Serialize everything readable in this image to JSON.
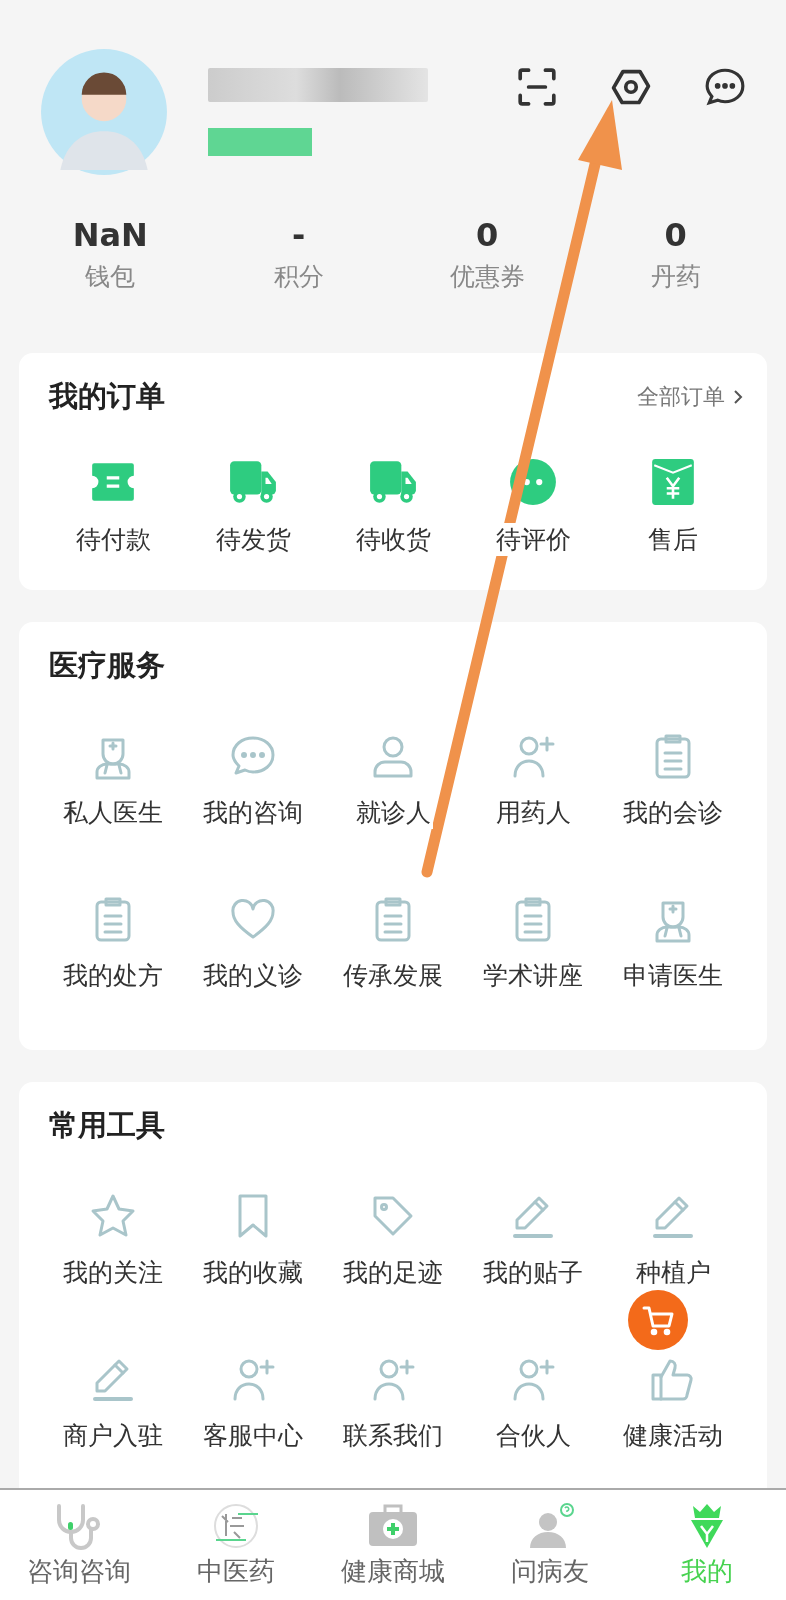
{
  "header": {
    "actions": [
      {
        "kind": "scan"
      },
      {
        "kind": "settings"
      },
      {
        "kind": "messages"
      }
    ]
  },
  "stats": [
    {
      "value": "NaN",
      "label": "钱包"
    },
    {
      "value": "-",
      "label": "积分"
    },
    {
      "value": "0",
      "label": "优惠券"
    },
    {
      "value": "0",
      "label": "丹药"
    }
  ],
  "orders": {
    "title": "我的订单",
    "link": "全部订单",
    "items": [
      {
        "label": "待付款",
        "kind": "ticket"
      },
      {
        "label": "待发货",
        "kind": "truck"
      },
      {
        "label": "待收货",
        "kind": "truck"
      },
      {
        "label": "待评价",
        "kind": "chat"
      },
      {
        "label": "售后",
        "kind": "envelope"
      }
    ]
  },
  "medical_services": {
    "title": "医疗服务",
    "items": [
      {
        "label": "私人医生",
        "kind": "doctor"
      },
      {
        "label": "我的咨询",
        "kind": "chat"
      },
      {
        "label": "就诊人",
        "kind": "person"
      },
      {
        "label": "用药人",
        "kind": "person-add"
      },
      {
        "label": "我的会诊",
        "kind": "clipboard"
      },
      {
        "label": "我的处方",
        "kind": "clipboard"
      },
      {
        "label": "我的义诊",
        "kind": "heart"
      },
      {
        "label": "传承发展",
        "kind": "clipboard"
      },
      {
        "label": "学术讲座",
        "kind": "clipboard"
      },
      {
        "label": "申请医生",
        "kind": "doctor"
      }
    ]
  },
  "tools": {
    "title": "常用工具",
    "items": [
      {
        "label": "我的关注",
        "kind": "star"
      },
      {
        "label": "我的收藏",
        "kind": "bookmark"
      },
      {
        "label": "我的足迹",
        "kind": "tag"
      },
      {
        "label": "我的贴子",
        "kind": "pencil"
      },
      {
        "label": "种植户",
        "kind": "pencil"
      },
      {
        "label": "商户入驻",
        "kind": "pencil"
      },
      {
        "label": "客服中心",
        "kind": "person-add"
      },
      {
        "label": "联系我们",
        "kind": "person-add"
      },
      {
        "label": "合伙人",
        "kind": "person-add"
      },
      {
        "label": "健康活动",
        "kind": "thumb"
      }
    ]
  },
  "tab_bar": [
    {
      "label": "咨询咨询",
      "kind": "stethoscope",
      "selected": false
    },
    {
      "label": "中医药",
      "kind": "logo",
      "selected": false
    },
    {
      "label": "健康商城",
      "kind": "kit",
      "selected": false
    },
    {
      "label": "问病友",
      "kind": "friend",
      "selected": false
    },
    {
      "label": "我的",
      "kind": "crown",
      "selected": true
    }
  ]
}
